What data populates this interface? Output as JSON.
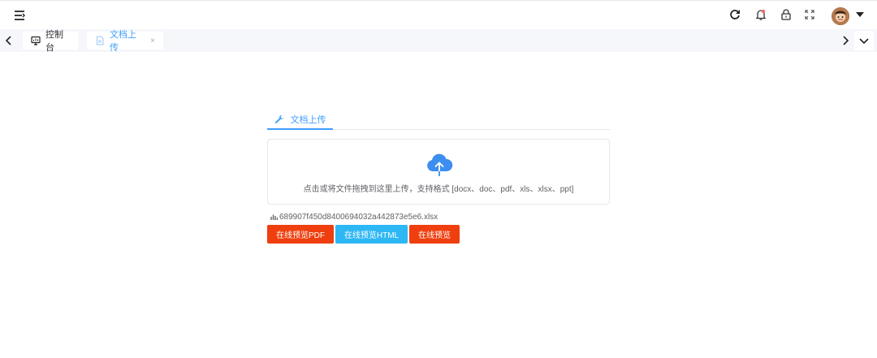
{
  "header": {
    "icons": [
      "menu-icon",
      "refresh-icon",
      "notification-bell-icon",
      "lock-icon",
      "fullscreen-icon",
      "avatar",
      "caret-down-icon"
    ]
  },
  "tabs": [
    {
      "label": "控制台",
      "icon": "monitor-icon",
      "active": false
    },
    {
      "label": "文档上传",
      "icon": "document-icon",
      "active": true,
      "closable": true,
      "close_glyph": "×"
    }
  ],
  "panel": {
    "tab_label": "文档上传",
    "tab_icon": "wrench-icon"
  },
  "upload": {
    "icon": "cloud-upload-icon",
    "hint": "点击或将文件拖拽到这里上传，支持格式 [docx、doc、pdf、xls、xlsx、ppt]"
  },
  "file": {
    "icon": "chart-icon",
    "name": "689907f450d8400694032a442873e5e6.xlsx"
  },
  "buttons": {
    "preview_pdf": "在线预览PDF",
    "preview_html": "在线预览HTML",
    "preview": "在线预览"
  },
  "colors": {
    "accent": "#409eff",
    "btn_pdf": "#ef3f0e",
    "btn_html": "#2db7f5",
    "btn_view": "#ef3f0e",
    "cloud": "#3d8ef0"
  }
}
